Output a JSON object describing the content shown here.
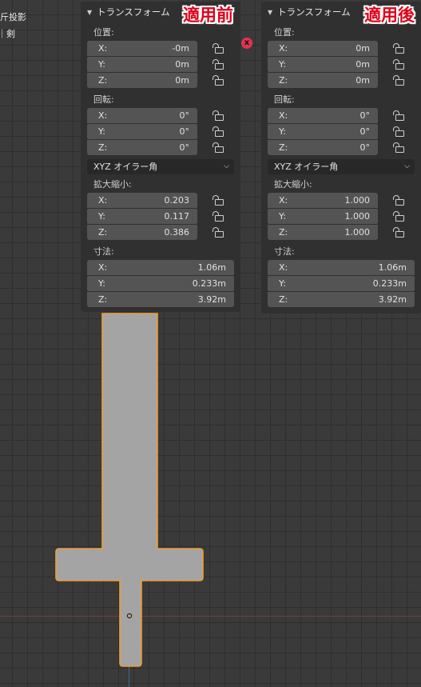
{
  "viewport": {
    "header_line1": "斤投影",
    "header_line2": "剣"
  },
  "badges": {
    "before": "適用前",
    "after": "適用後"
  },
  "colors": {
    "badge_red": "#e0001a",
    "selection_outline": "#f0a030",
    "x_axis": "#7a3a3a",
    "panel_bg": "#303030",
    "field_bg": "#545454"
  },
  "panel_before": {
    "title": "トランスフォーム",
    "location_label": "位置:",
    "location": [
      {
        "axis": "X:",
        "value": "-0m"
      },
      {
        "axis": "Y:",
        "value": "0m"
      },
      {
        "axis": "Z:",
        "value": "0m"
      }
    ],
    "rotation_label": "回転:",
    "rotation": [
      {
        "axis": "X:",
        "value": "0°"
      },
      {
        "axis": "Y:",
        "value": "0°"
      },
      {
        "axis": "Z:",
        "value": "0°"
      }
    ],
    "rotation_mode": "XYZ オイラー角",
    "scale_label": "拡大縮小:",
    "scale": [
      {
        "axis": "X:",
        "value": "0.203"
      },
      {
        "axis": "Y:",
        "value": "0.117"
      },
      {
        "axis": "Z:",
        "value": "0.386"
      }
    ],
    "dimensions_label": "寸法:",
    "dimensions": [
      {
        "axis": "X:",
        "value": "1.06m"
      },
      {
        "axis": "Y:",
        "value": "0.233m"
      },
      {
        "axis": "Z:",
        "value": "3.92m"
      }
    ]
  },
  "panel_after": {
    "title": "トランスフォーム",
    "location_label": "位置:",
    "location": [
      {
        "axis": "X:",
        "value": "0m"
      },
      {
        "axis": "Y:",
        "value": "0m"
      },
      {
        "axis": "Z:",
        "value": "0m"
      }
    ],
    "rotation_label": "回転:",
    "rotation": [
      {
        "axis": "X:",
        "value": "0°"
      },
      {
        "axis": "Y:",
        "value": "0°"
      },
      {
        "axis": "Z:",
        "value": "0°"
      }
    ],
    "rotation_mode": "XYZ オイラー角",
    "scale_label": "拡大縮小:",
    "scale": [
      {
        "axis": "X:",
        "value": "1.000"
      },
      {
        "axis": "Y:",
        "value": "1.000"
      },
      {
        "axis": "Z:",
        "value": "1.000"
      }
    ],
    "dimensions_label": "寸法:",
    "dimensions": [
      {
        "axis": "X:",
        "value": "1.06m"
      },
      {
        "axis": "Y:",
        "value": "0.233m"
      },
      {
        "axis": "Z:",
        "value": "3.92m"
      }
    ]
  },
  "icons": {
    "collapse": "triangle-down-icon",
    "lock": "unlocked-padlock-icon",
    "dropdown": "chevron-down-icon",
    "close": "close-icon"
  }
}
